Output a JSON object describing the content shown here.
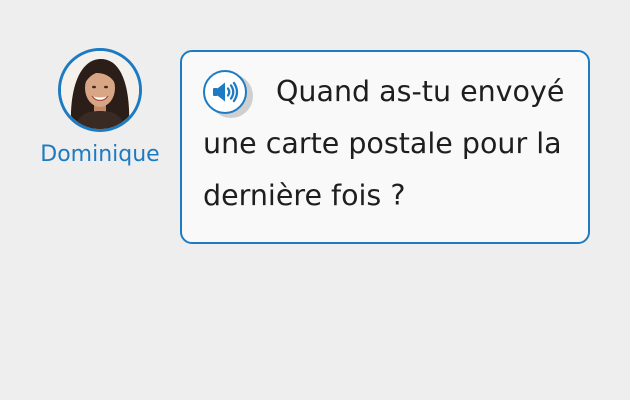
{
  "speaker": {
    "name": "Dominique",
    "avatar_icon": "woman-portrait-icon"
  },
  "bubble": {
    "audio_icon": "speaker-volume-icon",
    "message": "Quand as-tu envoyé une carte postale pour la dernière fois ?"
  },
  "colors": {
    "accent": "#1d7bc2",
    "background": "#eeeeee",
    "bubble_fill": "#f9f9f9",
    "text": "#1e1e1e"
  }
}
